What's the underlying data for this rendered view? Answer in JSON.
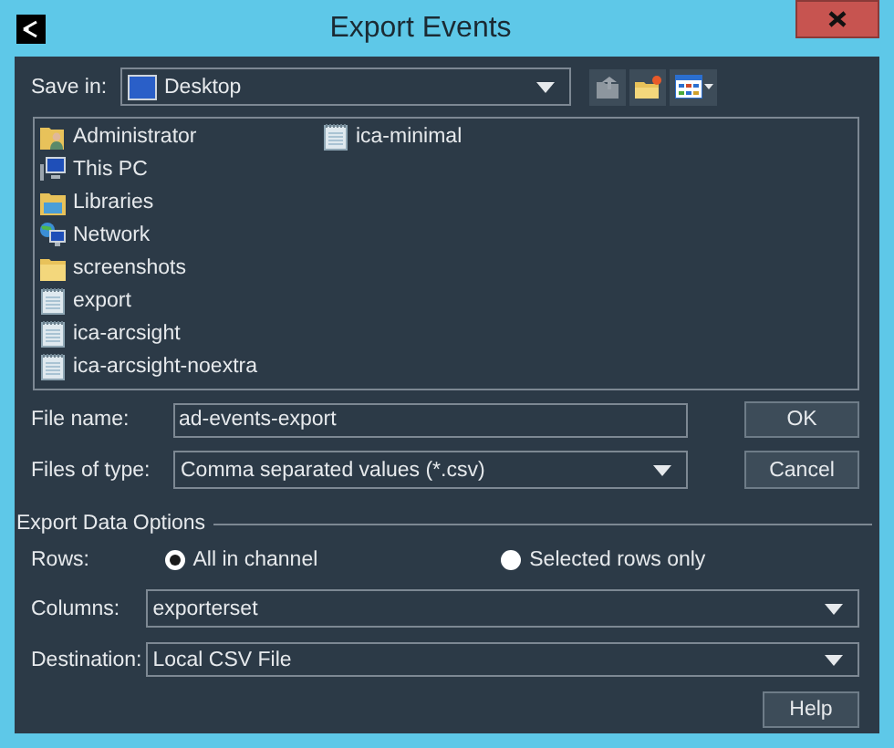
{
  "window": {
    "title": "Export Events"
  },
  "save_in": {
    "label": "Save in:",
    "value": "Desktop"
  },
  "files": [
    {
      "name": "Administrator",
      "kind": "user-folder"
    },
    {
      "name": "This PC",
      "kind": "computer"
    },
    {
      "name": "Libraries",
      "kind": "libraries"
    },
    {
      "name": "Network",
      "kind": "network"
    },
    {
      "name": "screenshots",
      "kind": "folder"
    },
    {
      "name": "export",
      "kind": "file"
    },
    {
      "name": "ica-arcsight",
      "kind": "file"
    },
    {
      "name": "ica-arcsight-noextra",
      "kind": "file"
    },
    {
      "name": "ica-minimal",
      "kind": "file"
    }
  ],
  "file_name": {
    "label": "File name:",
    "value": "ad-events-export"
  },
  "file_type": {
    "label": "Files of type:",
    "value": "Comma separated values (*.csv)"
  },
  "buttons": [
    {
      "label": "OK"
    },
    {
      "label": "Cancel"
    }
  ],
  "export_options": {
    "title": "Export Data Options",
    "rows": {
      "label": "Rows:",
      "options": [
        {
          "label": "All in channel",
          "selected": true
        },
        {
          "label": "Selected rows only",
          "selected": false
        }
      ]
    },
    "columns": {
      "label": "Columns:",
      "value": "exporterset"
    },
    "destination": {
      "label": "Destination:",
      "value": "Local CSV File"
    }
  },
  "help_button": "Help"
}
